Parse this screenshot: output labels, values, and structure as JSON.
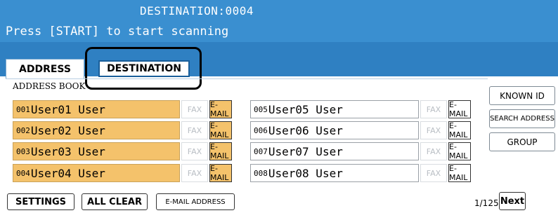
{
  "header": {
    "destination": "DESTINATION:0004",
    "message": "Press [START] to start scanning"
  },
  "tabs": {
    "address": "ADDRESS",
    "destination": "DESTINATION"
  },
  "address_book_label": "ADDRESS BOOK",
  "entries": [
    {
      "num": "001",
      "name": "User01 User",
      "fax": "FAX",
      "mail": "E-MAIL",
      "selected": true
    },
    {
      "num": "002",
      "name": "User02 User",
      "fax": "FAX",
      "mail": "E-MAIL",
      "selected": true
    },
    {
      "num": "003",
      "name": "User03 User",
      "fax": "FAX",
      "mail": "E-MAIL",
      "selected": true
    },
    {
      "num": "004",
      "name": "User04 User",
      "fax": "FAX",
      "mail": "E-MAIL",
      "selected": true
    },
    {
      "num": "005",
      "name": "User05 User",
      "fax": "FAX",
      "mail": "E-MAIL",
      "selected": false
    },
    {
      "num": "006",
      "name": "User06 User",
      "fax": "FAX",
      "mail": "E-MAIL",
      "selected": false
    },
    {
      "num": "007",
      "name": "User07 User",
      "fax": "FAX",
      "mail": "E-MAIL",
      "selected": false
    },
    {
      "num": "008",
      "name": "User08 User",
      "fax": "FAX",
      "mail": "E-MAIL",
      "selected": false
    }
  ],
  "side_buttons": {
    "known_id": "KNOWN ID",
    "search_address": "SEARCH ADDRESS",
    "group": "GROUP"
  },
  "bottom": {
    "settings": "SETTINGS",
    "all_clear": "ALL CLEAR",
    "email_address": "E-MAIL ADDRESS",
    "page": "1/125",
    "next": "Next"
  },
  "colors": {
    "header": "#3a8fd0",
    "selected": "#f4c26b"
  }
}
